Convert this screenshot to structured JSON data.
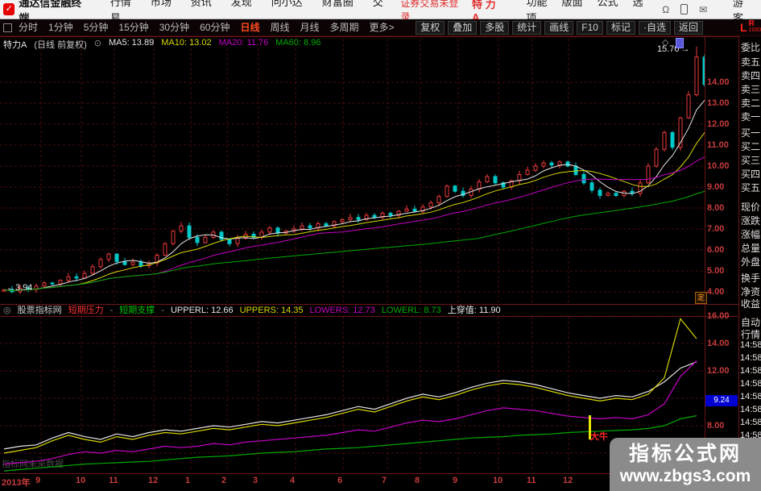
{
  "colors": {
    "up": "#ee3a3a",
    "down": "#00c8c8",
    "ma5": "#e6e6e6",
    "ma10": "#d8d800",
    "ma20": "#c400c4",
    "ma60": "#00aa00",
    "grid": "#4a0d0d",
    "frame": "#6e1515",
    "axis_text": "#c83c3c",
    "accent_red": "#ff3232",
    "accent_green": "#00c800",
    "signal_yellow": "#e8e800",
    "box_blue": "#0000d2"
  },
  "menubar": {
    "logo_glyph": "✓",
    "app_title": "通达信金融终端",
    "menus": [
      "行情",
      "市场",
      "资讯",
      "发现",
      "问小达",
      "财富圈",
      "交易"
    ],
    "login_status": "证券交易未登录",
    "stock_name": "特 力A",
    "right_menus": [
      "功能",
      "版面",
      "公式",
      "选项"
    ],
    "icons": [
      "headset-icon",
      "phone-icon",
      "mail-icon"
    ],
    "headset_glyph": "Ω",
    "mail_glyph": "✉",
    "user": "游客"
  },
  "toolbar": {
    "periods": [
      "分时",
      "1分钟",
      "5分钟",
      "15分钟",
      "30分钟",
      "60分钟",
      "日线",
      "周线",
      "月线",
      "多周期",
      "更多>"
    ],
    "active": "日线",
    "buttons": [
      "复权",
      "叠加",
      "多股",
      "统计",
      "画线",
      "F10",
      "标记",
      "·自选",
      "返回"
    ],
    "lr": {
      "l": "L",
      "r": "R",
      "num": "1000"
    }
  },
  "main_chart": {
    "title_segments": [
      {
        "text": "特力A",
        "color": "#e8e8e8"
      },
      {
        "text": "(日线 前复权)",
        "color": "#c8c8c8"
      },
      {
        "text": "⊙",
        "color": "#909090"
      },
      {
        "text": "MA5: 13.89",
        "color": "#e6e6e6"
      },
      {
        "text": "MA10: 13.02",
        "color": "#d8d800"
      },
      {
        "text": "MA20: 11.76",
        "color": "#c400c4"
      },
      {
        "text": "MA60: 8.96",
        "color": "#00aa00"
      }
    ],
    "high_label": "15.70",
    "high_arrow": "→",
    "low_label": "←3.94",
    "diamond": "◇",
    "flag_badge": "定"
  },
  "indicator_panel": {
    "segments": [
      {
        "text": "◎",
        "color": "#909090"
      },
      {
        "text": "股票指标网",
        "color": "#d0d0d0"
      },
      {
        "text": "短期压力",
        "color": "#ff3232"
      },
      {
        "text": "-",
        "color": "#909090"
      },
      {
        "text": "短期支撑",
        "color": "#00c800"
      },
      {
        "text": "-",
        "color": "#909090"
      },
      {
        "text": "UPPERL: 12.66",
        "color": "#e6e6e6"
      },
      {
        "text": "UPPERS: 14.35",
        "color": "#d8d800"
      },
      {
        "text": "LOWERS: 12.73",
        "color": "#c400c4"
      },
      {
        "text": "LOWERL: 8.73",
        "color": "#00aa00"
      },
      {
        "text": "上穿值: 11.90",
        "color": "#e6e6e6"
      }
    ],
    "signal_label": "大牛",
    "current_value_box": "9.24"
  },
  "chart_data": [
    {
      "type": "candlestick",
      "title": "特力A 日线 前复权",
      "high": 15.7,
      "low": 3.94,
      "ylim": [
        3.4,
        16.2
      ],
      "y_ticks": [
        "14.00",
        "13.00",
        "12.00",
        "11.00",
        "10.00",
        "9.00",
        "8.00",
        "7.00",
        "6.00",
        "5.00",
        "4.00"
      ],
      "y_tick_values": [
        14,
        13,
        12,
        11,
        10,
        9,
        8,
        7,
        6,
        5,
        4
      ],
      "x_labels": [
        {
          "t": "2013年",
          "x": 2
        },
        {
          "t": "9",
          "x": 44
        },
        {
          "t": "10",
          "x": 94
        },
        {
          "t": "11",
          "x": 135
        },
        {
          "t": "12",
          "x": 184
        },
        {
          "t": "1",
          "x": 230
        },
        {
          "t": "2",
          "x": 275
        },
        {
          "t": "3",
          "x": 314
        },
        {
          "t": "4",
          "x": 360
        },
        {
          "t": "6",
          "x": 419
        },
        {
          "t": "7",
          "x": 474
        },
        {
          "t": "8",
          "x": 515
        },
        {
          "t": "9",
          "x": 562
        },
        {
          "t": "10",
          "x": 612
        },
        {
          "t": "11",
          "x": 654
        },
        {
          "t": "12",
          "x": 699
        }
      ],
      "closes": [
        4.1,
        4.0,
        4.18,
        4.12,
        4.28,
        4.42,
        4.38,
        4.55,
        4.72,
        4.66,
        4.88,
        5.2,
        5.55,
        5.8,
        5.45,
        5.3,
        5.42,
        5.25,
        5.38,
        5.75,
        6.3,
        6.9,
        7.15,
        6.6,
        6.35,
        6.6,
        6.85,
        6.5,
        6.3,
        6.55,
        6.75,
        6.6,
        6.85,
        7.05,
        6.8,
        6.9,
        7.0,
        7.15,
        7.05,
        7.25,
        7.15,
        7.35,
        7.45,
        7.55,
        7.45,
        7.65,
        7.55,
        7.75,
        7.65,
        7.85,
        7.95,
        7.85,
        8.05,
        8.25,
        8.55,
        9.05,
        8.8,
        8.6,
        8.9,
        9.25,
        9.5,
        9.2,
        9.0,
        9.3,
        9.6,
        9.8,
        10.0,
        10.15,
        10.05,
        10.2,
        10.0,
        9.6,
        9.2,
        8.85,
        8.6,
        8.7,
        8.6,
        8.8,
        8.7,
        9.2,
        10.0,
        10.8,
        11.6,
        10.9,
        12.3,
        13.4,
        15.2,
        13.89
      ],
      "ma_periods": [
        5,
        10,
        20,
        60
      ],
      "ma_display": {
        "MA5": 13.89,
        "MA10": 13.02,
        "MA20": 11.76,
        "MA60": 8.96
      }
    },
    {
      "type": "line",
      "ylim": [
        4.6,
        16.2
      ],
      "y_ticks": [
        {
          "t": "16.00",
          "v": 16
        },
        {
          "t": "14.00",
          "v": 14
        },
        {
          "t": "12.00",
          "v": 12
        },
        {
          "t": "8.00",
          "v": 8
        }
      ],
      "grid_values": [
        16,
        14,
        12,
        10,
        8,
        6
      ],
      "series": [
        {
          "name": "UPPERL",
          "color": "#e6e6e6",
          "values": [
            6.3,
            6.5,
            6.6,
            7.1,
            7.5,
            7.2,
            7.0,
            7.4,
            7.2,
            7.5,
            7.7,
            7.6,
            7.8,
            8.0,
            7.9,
            8.1,
            8.3,
            8.2,
            8.4,
            8.6,
            8.8,
            9.1,
            9.4,
            9.2,
            9.6,
            10.0,
            10.3,
            10.1,
            10.4,
            10.8,
            11.1,
            11.3,
            11.2,
            11.0,
            10.7,
            10.4,
            10.2,
            10.0,
            10.2,
            10.1,
            10.5,
            11.2,
            12.2,
            12.66
          ]
        },
        {
          "name": "UPPERS",
          "color": "#d8d800",
          "values": [
            6.0,
            6.2,
            6.4,
            6.9,
            7.3,
            7.0,
            6.8,
            7.2,
            7.0,
            7.3,
            7.5,
            7.4,
            7.6,
            7.8,
            7.7,
            7.9,
            8.1,
            8.0,
            8.2,
            8.4,
            8.6,
            8.9,
            9.2,
            9.0,
            9.4,
            9.8,
            10.1,
            9.9,
            10.2,
            10.6,
            10.9,
            11.1,
            11.0,
            10.8,
            10.5,
            10.2,
            10.0,
            9.8,
            10.0,
            9.9,
            10.3,
            11.5,
            15.8,
            14.35
          ]
        },
        {
          "name": "LOWERS",
          "color": "#c400c4",
          "values": [
            5.2,
            5.3,
            5.4,
            5.6,
            5.9,
            6.1,
            6.0,
            6.2,
            6.1,
            6.3,
            6.5,
            6.4,
            6.5,
            6.7,
            6.6,
            6.8,
            6.9,
            7.0,
            7.1,
            7.2,
            7.3,
            7.5,
            7.7,
            7.6,
            7.9,
            8.2,
            8.4,
            8.3,
            8.5,
            8.8,
            9.1,
            9.3,
            9.2,
            9.1,
            8.9,
            8.7,
            8.6,
            8.5,
            8.6,
            8.5,
            8.8,
            9.6,
            11.6,
            12.73
          ]
        },
        {
          "name": "LOWERL",
          "color": "#00aa00",
          "values": [
            4.7,
            4.8,
            4.9,
            5.0,
            5.1,
            5.2,
            5.25,
            5.3,
            5.35,
            5.4,
            5.5,
            5.6,
            5.7,
            5.75,
            5.8,
            5.9,
            6.0,
            6.05,
            6.1,
            6.2,
            6.3,
            6.35,
            6.4,
            6.5,
            6.6,
            6.7,
            6.8,
            6.9,
            7.0,
            7.1,
            7.15,
            7.2,
            7.3,
            7.35,
            7.4,
            7.5,
            7.55,
            7.6,
            7.65,
            7.7,
            7.8,
            8.0,
            8.5,
            8.73
          ]
        }
      ],
      "current_value": 9.24,
      "signal": {
        "label": "大牛",
        "x": 733
      }
    }
  ],
  "sidebar": {
    "rows": [
      "委比",
      "卖五",
      "卖四",
      "卖三",
      "卖二",
      "卖一",
      "买一",
      "买二",
      "买三",
      "买四",
      "买五",
      "现价",
      "涨跌",
      "涨幅",
      "总量",
      "外盘",
      "换手",
      "净资",
      "收益",
      "自动",
      "行情"
    ],
    "times": [
      "14:58",
      "14:58",
      "14:58",
      "14:58",
      "14:58",
      "14:58",
      "14:58",
      "14:58"
    ]
  },
  "watermark": {
    "line1": "指标公式网",
    "line2": "www.zbgs3.com"
  },
  "corner_watermark": "指标网未来数据"
}
